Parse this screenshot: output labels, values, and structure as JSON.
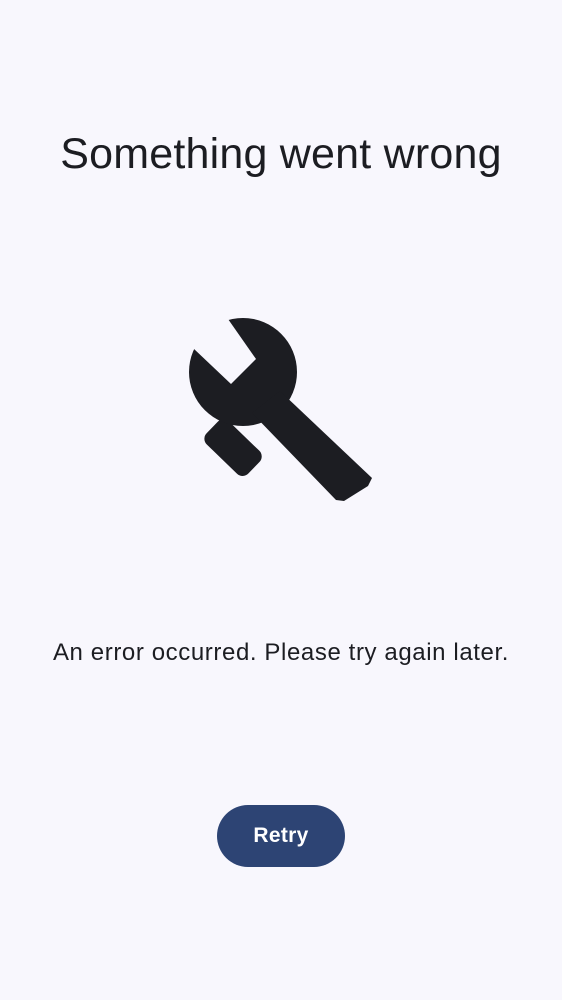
{
  "error_screen": {
    "title": "Something went wrong",
    "icon": "wrench-icon",
    "message": "An error occurred. Please try again later.",
    "retry_label": "Retry"
  },
  "colors": {
    "background": "#f8f7fd",
    "text": "#1c1d22",
    "icon": "#1c1d22",
    "button_background": "#2d4474",
    "button_text": "#ffffff"
  }
}
